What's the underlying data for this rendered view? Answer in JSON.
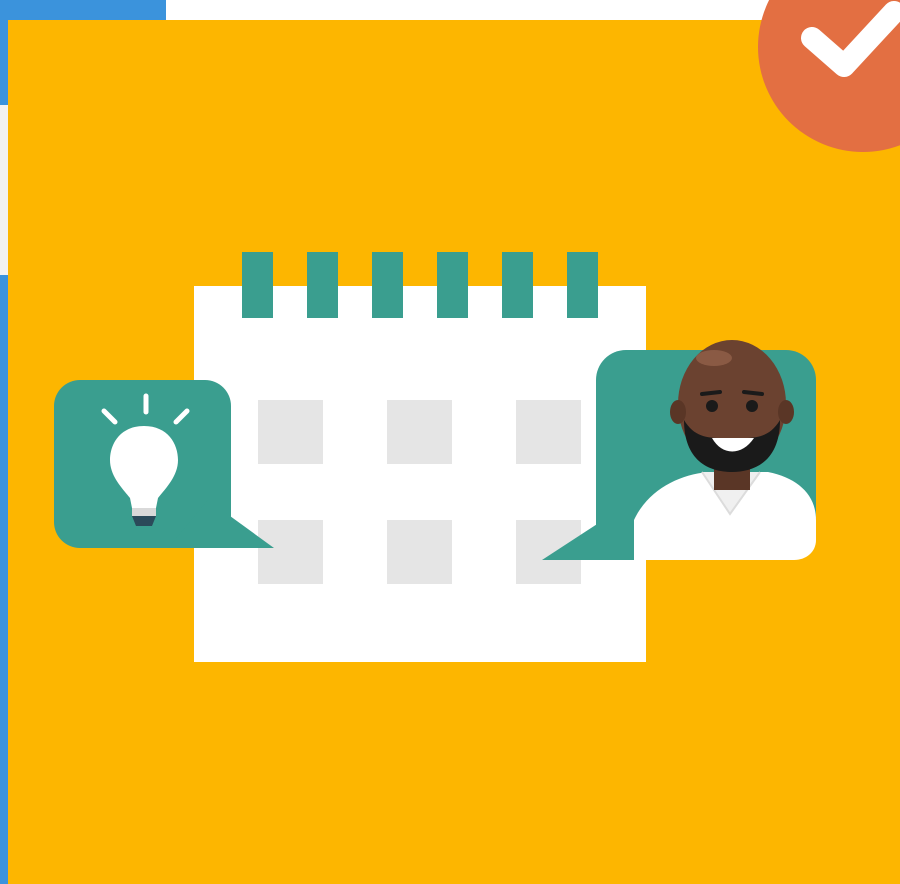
{
  "tile": {
    "background": "#fdb600",
    "accent_teal": "#3a9e8f",
    "calendar_cell": "#e5e5e5",
    "calendar_paper": "#ffffff"
  },
  "badge": {
    "icon": "checkmark-icon",
    "color": "#e36f42"
  },
  "left_bubble": {
    "icon": "lightbulb-icon"
  },
  "right_bubble": {
    "icon": "person-avatar"
  },
  "calendar": {
    "icon": "calendar-icon",
    "rings": 6,
    "rows": 2,
    "columns": 3
  }
}
